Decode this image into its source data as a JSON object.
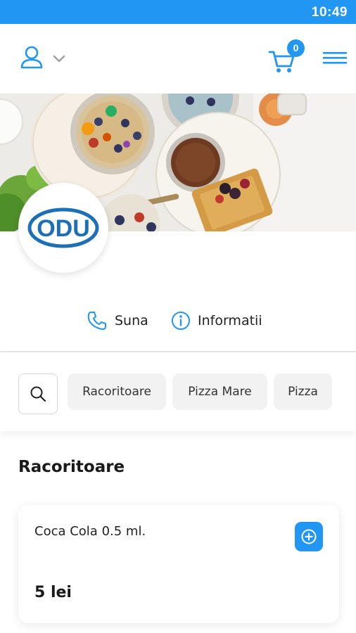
{
  "status_bar": {
    "time": "10:49"
  },
  "header": {
    "profile_icon": "user-icon",
    "dropdown_icon": "chevron-down-icon",
    "cart_icon": "cart-icon",
    "cart_count": "0",
    "menu_icon": "hamburger-menu-icon"
  },
  "hero": {
    "image": "breakfast-food-photo",
    "logo_text": "ODU"
  },
  "actions": {
    "call_label": "Suna",
    "info_label": "Informatii"
  },
  "categories": {
    "search_icon": "search-icon",
    "items": [
      {
        "label": "Racoritoare"
      },
      {
        "label": "Pizza Mare"
      },
      {
        "label": "Pizza"
      }
    ]
  },
  "section": {
    "title": "Racoritoare",
    "products": [
      {
        "name": "Coca Cola 0.5 ml.",
        "price": "5 lei"
      }
    ]
  },
  "colors": {
    "accent": "#2196f3",
    "logo_blue": "#1d6fb8",
    "chip_bg": "#f2f2f2"
  }
}
